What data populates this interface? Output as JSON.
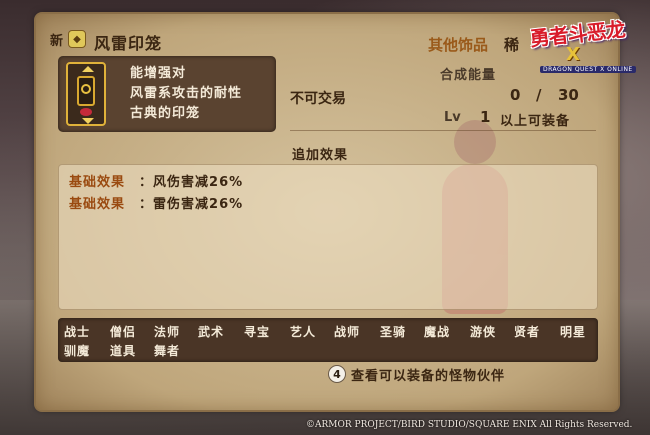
{
  "item": {
    "new_label": "新",
    "name": "风雷印笼",
    "category": "其他饰品",
    "rarity": "稀"
  },
  "logo": {
    "title": "勇者斗恶龙",
    "mark": "X",
    "subtitle": "DRAGON QUEST X ONLINE"
  },
  "description": {
    "lines": [
      "能增强对",
      "风雷系攻击的耐性",
      "古典的印笼"
    ]
  },
  "trade": "不可交易",
  "synthesis": {
    "label": "合成能量",
    "current": "0",
    "separator": "/",
    "max": "30"
  },
  "level": {
    "label": "Lv",
    "value": "1",
    "text": "以上可装备"
  },
  "added_effects": {
    "title": "追加效果",
    "rows": [
      {
        "label": "基础效果",
        "colon": "：",
        "value": "风伤害减26%"
      },
      {
        "label": "基础效果",
        "colon": "：",
        "value": "雷伤害减26%"
      }
    ]
  },
  "jobs": {
    "row1": [
      "战士",
      "僧侣",
      "法师",
      "武术",
      "寻宝",
      "艺人",
      "战师",
      "圣骑",
      "魔战",
      "游侠",
      "贤者",
      "明星"
    ],
    "row2": [
      "驯魔",
      "道具",
      "舞者"
    ]
  },
  "monster_button": {
    "key": "4",
    "label": "查看可以装备的怪物伙伴"
  },
  "copyright": "©ARMOR PROJECT/BIRD STUDIO/SQUARE ENIX All Rights Reserved.",
  "colors": {
    "parchment": "#cbb48c",
    "dark_box": "#5a4330",
    "label_orange": "#9a4a10",
    "text_dark": "#3b2612"
  }
}
